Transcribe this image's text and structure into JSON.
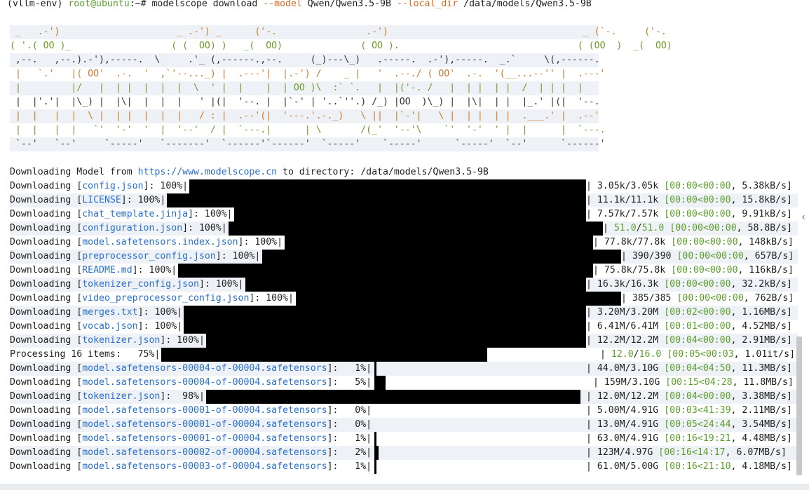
{
  "prompt": {
    "env": "(vllm-env)",
    "user_host": "root@ubuntu",
    "path_sep": ":~# ",
    "cmd": "modelscope download",
    "flag_model": "--model",
    "model_arg": " Qwen/Qwen3.5-9B ",
    "flag_local": "--local_dir",
    "dir_arg": " /data/models/Qwen3.5-9B"
  },
  "banner": [
    " _   .-')                     _ .-') _      ('-.                .-')                                   _ (`-.     ('-.     ",
    "( '.( OO )_                  ( (  OO) )   _(  OO)              ( OO ).                                ( (OO  )  _(  OO)    ",
    " ,--.   ,--.).-'),-----.  \\     .'_ (,------.,--.     (_)---\\_)   .-----.  .-'),-----.  _.`     \\(,------.   ",
    " |   `.'   |( OO'  .-.  '  ,`'--..._) |  .---'|  |.-') /    _ |   '  .--./ ( OO'  .-.  '(__...--'' |  .---'   ",
    " |         |/   |  | |  |  |  |  \\  ' |  |    |  | OO )\\  :` `.   |  |('-. /   |  | |  | |  /  | | |  |       ",
    " |  |'.'|  |\\_) |  |\\|  |  |  |   ' |(|  '--. |  |`-' | '..`''.) /_) |OO  )\\_) |  |\\|  | |  |_.' |(|  '--.    ",
    " |  |   |  |  \\ |  | |  |  |  |   / : |  .--'(|  '---.'.-._)   \\ ||  |`-'|   \\ |  | |  | |  .___.' |  .--'    ",
    " |  |   |  |   `'  '-'  '  |  '--'  / |  `---.|      | \\       /(_'  '--'\\    `'  '-'  ' |  |      |  `---.   ",
    " `--'   `--'     `-----'   `-------'  `------'`------'  `-----'    `-----'      `-----'  `--'      `------'   "
  ],
  "download_header": {
    "prefix": "Downloading Model from ",
    "url": "https://www.modelscope.cn",
    "middle": " to directory: ",
    "dir": "/data/models/Qwen3.5-9B"
  },
  "rows": [
    {
      "label": "Downloading [",
      "file": "config.json",
      "suffix": "]: 100%|",
      "done": "3.05k",
      "total": "3.05k",
      "elapsed": "00:00",
      "remaining": "00:00",
      "rate": "5.38kB/s"
    },
    {
      "label": "Downloading [",
      "file": "LICENSE",
      "suffix": "]: 100%|",
      "done": "11.1k",
      "total": "11.1k",
      "elapsed": "00:00",
      "remaining": "00:00",
      "rate": "15.8kB/s"
    },
    {
      "label": "Downloading [",
      "file": "chat_template.jinja",
      "suffix": "]: 100%|",
      "done": "7.57k",
      "total": "7.57k",
      "elapsed": "00:00",
      "remaining": "00:00",
      "rate": "9.91kB/s"
    },
    {
      "label": "Downloading [",
      "file": "configuration.json",
      "suffix": "]: 100%|",
      "done": "51.0",
      "total": "51.0",
      "elapsed": "00:00",
      "remaining": "00:00",
      "rate": "58.8B/s"
    },
    {
      "label": "Downloading [",
      "file": "model.safetensors.index.json",
      "suffix": "]: 100%|",
      "done": "77.8k",
      "total": "77.8k",
      "elapsed": "00:00",
      "remaining": "00:00",
      "rate": "148kB/s"
    },
    {
      "label": "Downloading [",
      "file": "preprocessor_config.json",
      "suffix": "]: 100%|",
      "done": "390",
      "total": "390",
      "elapsed": "00:00",
      "remaining": "00:00",
      "rate": "657B/s"
    },
    {
      "label": "Downloading [",
      "file": "README.md",
      "suffix": "]: 100%|",
      "done": "75.8k",
      "total": "75.8k",
      "elapsed": "00:00",
      "remaining": "00:00",
      "rate": "116kB/s"
    },
    {
      "label": "Downloading [",
      "file": "tokenizer_config.json",
      "suffix": "]: 100%|",
      "done": "16.3k",
      "total": "16.3k",
      "elapsed": "00:00",
      "remaining": "00:00",
      "rate": "32.2kB/s"
    },
    {
      "label": "Downloading [",
      "file": "video_preprocessor_config.json",
      "suffix": "]: 100%|",
      "done": "385",
      "total": "385",
      "elapsed": "00:00",
      "remaining": "00:00",
      "rate": "762B/s"
    },
    {
      "label": "Downloading [",
      "file": "merges.txt",
      "suffix": "]: 100%|",
      "done": "3.20M",
      "total": "3.20M",
      "elapsed": "00:02",
      "remaining": "00:00",
      "rate": "1.16MB/s"
    },
    {
      "label": "Downloading [",
      "file": "vocab.json",
      "suffix": "]: 100%|",
      "done": "6.41M",
      "total": "6.41M",
      "elapsed": "00:01",
      "remaining": "00:00",
      "rate": "4.52MB/s"
    },
    {
      "label": "Downloading [",
      "file": "tokenizer.json",
      "suffix": "]: 100%|",
      "done": "12.2M",
      "total": "12.2M",
      "elapsed": "00:04",
      "remaining": "00:00",
      "rate": "2.91MB/s"
    },
    {
      "label": "Processing 16 items:  ",
      "file": "",
      "suffix": " 75%|",
      "done": "12.0",
      "total": "16.0",
      "elapsed": "00:05",
      "remaining": "00:03",
      "rate": "1.01it/s"
    },
    {
      "label": "Downloading [",
      "file": "model.safetensors-00004-of-00004.safetensors",
      "suffix": "]:   1%|",
      "done": "44.0M",
      "total": "3.10G",
      "elapsed": "00:04",
      "remaining": "04:50",
      "rate": "11.3MB/s"
    },
    {
      "label": "Downloading [",
      "file": "model.safetensors-00004-of-00004.safetensors",
      "suffix": "]:   5%|",
      "done": "159M",
      "total": "3.10G",
      "elapsed": "00:15",
      "remaining": "04:28",
      "rate": "11.8MB/s"
    },
    {
      "label": "Downloading [",
      "file": "tokenizer.json",
      "suffix": "]:  98%|",
      "done": "12.0M",
      "total": "12.2M",
      "elapsed": "00:04",
      "remaining": "00:00",
      "rate": "3.38MB/s"
    },
    {
      "label": "Downloading [",
      "file": "model.safetensors-00001-of-00004.safetensors",
      "suffix": "]:   0%|",
      "done": "5.00M",
      "total": "4.91G",
      "elapsed": "00:03",
      "remaining": "41:39",
      "rate": "2.11MB/s"
    },
    {
      "label": "Downloading [",
      "file": "model.safetensors-00001-of-00004.safetensors",
      "suffix": "]:   0%|",
      "done": "13.0M",
      "total": "4.91G",
      "elapsed": "00:05",
      "remaining": "24:44",
      "rate": "3.54MB/s"
    },
    {
      "label": "Downloading [",
      "file": "model.safetensors-00001-of-00004.safetensors",
      "suffix": "]:   1%|",
      "done": "63.0M",
      "total": "4.91G",
      "elapsed": "00:16",
      "remaining": "19:21",
      "rate": "4.48MB/s"
    },
    {
      "label": "Downloading [",
      "file": "model.safetensors-00002-of-00004.safetensors",
      "suffix": "]:   2%|",
      "done": "123M",
      "total": "4.97G",
      "elapsed": "00:16",
      "remaining": "14:17",
      "rate": "6.07MB/s"
    },
    {
      "label": "Downloading [",
      "file": "model.safetensors-00003-of-00004.safetensors",
      "suffix": "]:   1%|",
      "done": "61.0M",
      "total": "5.00G",
      "elapsed": "00:16",
      "remaining": "21:10",
      "rate": "4.18MB/s"
    }
  ],
  "colors": {
    "accent_blue": "#2a6fc9",
    "accent_green": "#5c9c2d",
    "orange": "#d2691e"
  }
}
